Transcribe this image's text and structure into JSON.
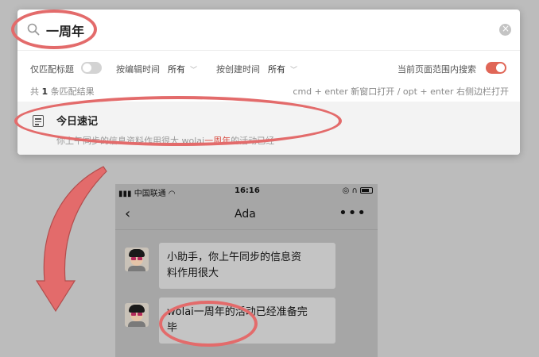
{
  "search": {
    "query": "一周年",
    "icon": "search-icon",
    "clear_icon": "close-icon"
  },
  "filters": {
    "title_only_label": "仅匹配标题",
    "title_only_on": false,
    "edit_time_label": "按编辑时间",
    "edit_time_value": "所有",
    "create_time_label": "按创建时间",
    "create_time_value": "所有",
    "scope_label": "当前页面范围内搜索",
    "scope_on": true
  },
  "results_meta": {
    "prefix": "共",
    "count": "1",
    "suffix": "条匹配结果",
    "shortcut_hint": "cmd + enter 新窗口打开 / opt + enter 右侧边栏打开"
  },
  "results": [
    {
      "title": "今日速记",
      "snippet_before": "你上午同步的信息资料作用很大 wolai",
      "snippet_highlight": "一周年",
      "snippet_after": "的活动已经"
    }
  ],
  "phone": {
    "carrier": "中国联通",
    "time": "16:16",
    "chat_title": "Ada",
    "back_icon": "chevron-left-icon",
    "more_icon": "more-icon",
    "messages": [
      {
        "line1": "小助手，你上午同步的信息资",
        "line2": "料作用很大"
      },
      {
        "line1": "wolai一周年的活动已经准备完",
        "line2": "毕"
      }
    ]
  },
  "colors": {
    "accent_red": "#e06657",
    "annotation_red": "#e36b6b",
    "highlight": "#d84a3f"
  }
}
